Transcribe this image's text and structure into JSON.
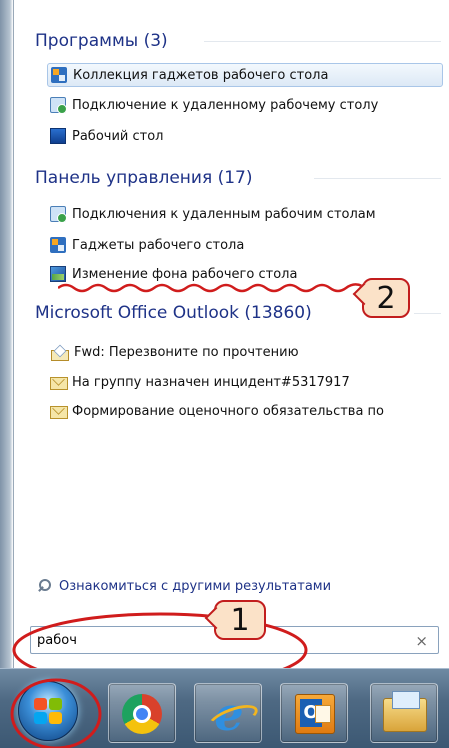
{
  "groups": {
    "programs": {
      "header": "Программы (3)",
      "items": [
        {
          "label": "Коллекция гаджетов рабочего стола",
          "icon": "gadgets-icon"
        },
        {
          "label": "Подключение к удаленному рабочему столу",
          "icon": "remote-desktop-icon"
        },
        {
          "label": "Рабочий стол",
          "icon": "desktop-icon"
        }
      ]
    },
    "control_panel": {
      "header": "Панель управления (17)",
      "items": [
        {
          "label": "Подключения к удаленным рабочим столам",
          "icon": "remote-desktop-icon"
        },
        {
          "label": "Гаджеты рабочего стола",
          "icon": "gadgets-icon"
        },
        {
          "label": "Изменение фона рабочего стола",
          "icon": "wallpaper-icon"
        }
      ]
    },
    "outlook": {
      "header": "Microsoft Office Outlook (13860)",
      "items": [
        {
          "label": "Fwd: Перезвоните по прочтению",
          "icon": "open-envelope-icon"
        },
        {
          "label": "На группу назначен инцидент#5317917",
          "icon": "envelope-icon"
        },
        {
          "label": "Формирование оценочного обязательства по",
          "icon": "envelope-icon"
        }
      ]
    }
  },
  "more_results": "Ознакомиться с другими результатами",
  "search": {
    "value": "рабоч",
    "clear": "×"
  },
  "callouts": {
    "one": "1",
    "two": "2"
  },
  "taskbar": [
    "start-orb",
    "chrome-icon",
    "internet-explorer-icon",
    "outlook-icon",
    "file-explorer-icon"
  ],
  "colors": {
    "header_blue": "#1e3287",
    "annotation_red": "#d01c1c",
    "callout_fill": "#fbe2c8",
    "taskbar": "#4e6983"
  }
}
